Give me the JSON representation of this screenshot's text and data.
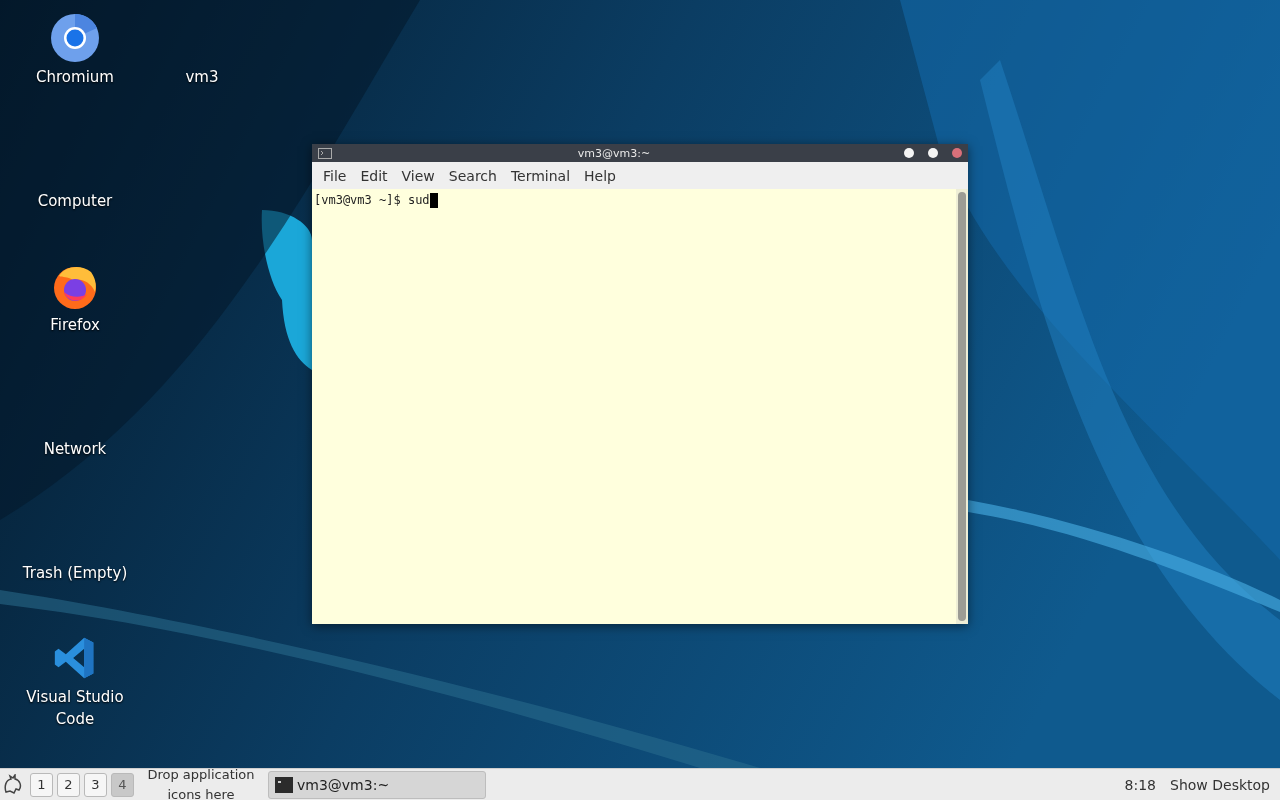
{
  "desktop_icons": [
    [
      {
        "label": "Chromium",
        "kind": "chromium"
      },
      {
        "label": "Computer",
        "kind": "none"
      },
      {
        "label": "Firefox",
        "kind": "firefox"
      },
      {
        "label": "Network",
        "kind": "none"
      },
      {
        "label": "Trash (Empty)",
        "kind": "none"
      },
      {
        "label": "Visual Studio Code",
        "kind": "vscode"
      }
    ],
    [
      {
        "label": "vm3",
        "kind": "none"
      }
    ]
  ],
  "terminal": {
    "title": "vm3@vm3:~",
    "menu": [
      "File",
      "Edit",
      "View",
      "Search",
      "Terminal",
      "Help"
    ],
    "lines": [
      "[vm3@vm3 ~]$ sud"
    ],
    "cursor": true
  },
  "taskbar": {
    "workspaces": [
      {
        "label": "1",
        "selected": false
      },
      {
        "label": "2",
        "selected": false
      },
      {
        "label": "3",
        "selected": false
      },
      {
        "label": "4",
        "selected": true
      }
    ],
    "launcher_hint": "Drop application icons here",
    "tasks": [
      {
        "label": "vm3@vm3:~",
        "selected": false
      }
    ],
    "clock": "8:18",
    "show_desktop": "Show Desktop"
  }
}
